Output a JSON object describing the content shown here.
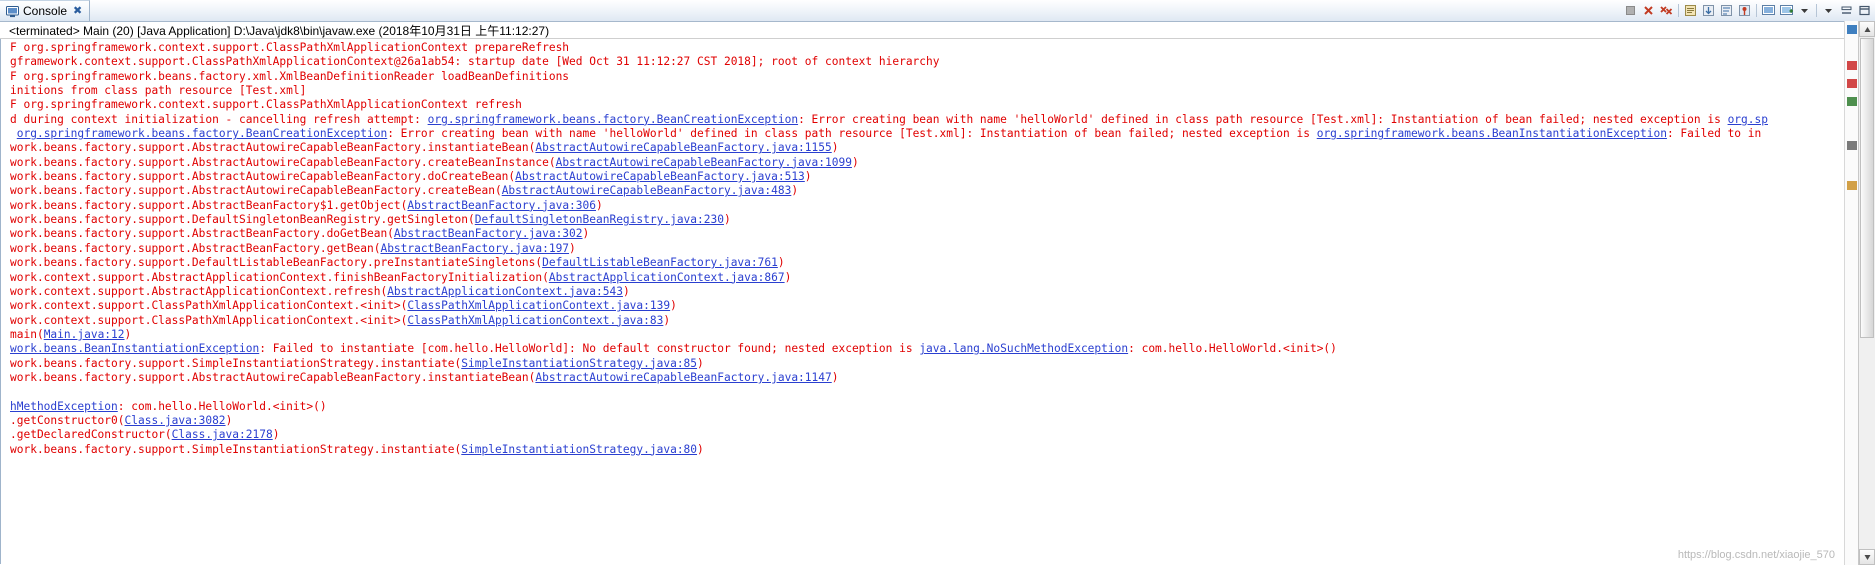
{
  "view": {
    "tab": {
      "label": "Console",
      "icon": "console-icon",
      "close_glyph": "✖"
    },
    "launch_line": "<terminated> Main (20) [Java Application] D:\\Java\\jdk8\\bin\\javaw.exe (2018年10月31日 上午11:12:27)",
    "watermark": "https://blog.csdn.net/xiaojie_570"
  },
  "toolbar": {
    "buttons": [
      {
        "name": "terminate-button",
        "label": "Terminate",
        "glyph": "■"
      },
      {
        "name": "remove-launch-button",
        "label": "Remove Launch",
        "glyph": "✖"
      },
      {
        "name": "remove-all-terminated-button",
        "label": "Remove All Terminated Launches",
        "glyph": "✖✖"
      },
      {
        "name": "clear-console-button",
        "label": "Clear Console",
        "glyph": "⌧"
      },
      {
        "name": "scroll-lock-button",
        "label": "Scroll Lock",
        "glyph": "↧"
      },
      {
        "name": "word-wrap-button",
        "label": "Word Wrap",
        "glyph": "↵"
      },
      {
        "name": "pin-console-button",
        "label": "Pin Console",
        "glyph": "⚓"
      },
      {
        "name": "display-selected-console-button",
        "label": "Display Selected Console",
        "glyph": "▣"
      },
      {
        "name": "open-console-button",
        "label": "Open Console",
        "glyph": "＋"
      },
      {
        "name": "view-menu-button",
        "label": "View Menu",
        "glyph": "▼"
      },
      {
        "name": "minimize-button",
        "label": "Minimize",
        "glyph": "—"
      },
      {
        "name": "maximize-button",
        "label": "Maximize",
        "glyph": "□"
      }
    ]
  },
  "console": {
    "lines": [
      {
        "t": "stack",
        "segments": [
          {
            "text": "F org.springframework.context.support.ClassPathXmlApplicationContext prepareRefresh",
            "link": false
          }
        ]
      },
      {
        "t": "stack",
        "segments": [
          {
            "text": "gframework.context.support.ClassPathXmlApplicationContext@26a1ab54: startup date [Wed Oct 31 11:12:27 CST 2018]; root of context hierarchy",
            "link": false
          }
        ]
      },
      {
        "t": "stack",
        "segments": [
          {
            "text": "F org.springframework.beans.factory.xml.XmlBeanDefinitionReader loadBeanDefinitions",
            "link": false
          }
        ]
      },
      {
        "t": "stack",
        "segments": [
          {
            "text": "initions from class path resource [Test.xml]",
            "link": false
          }
        ]
      },
      {
        "t": "stack",
        "segments": [
          {
            "text": "F org.springframework.context.support.ClassPathXmlApplicationContext refresh",
            "link": false
          }
        ]
      },
      {
        "t": "stack",
        "segments": [
          {
            "text": "d during context initialization - cancelling refresh attempt: ",
            "link": false
          },
          {
            "text": "org.springframework.beans.factory.BeanCreationException",
            "link": true
          },
          {
            "text": ": Error creating bean with name 'helloWorld' defined in class path resource [Test.xml]: Instantiation of bean failed; nested exception is ",
            "link": false
          },
          {
            "text": "org.sp",
            "link": true
          }
        ]
      },
      {
        "t": "stack",
        "segments": [
          {
            "text": " ",
            "link": false
          },
          {
            "text": "org.springframework.beans.factory.BeanCreationException",
            "link": true
          },
          {
            "text": ": Error creating bean with name 'helloWorld' defined in class path resource [Test.xml]: Instantiation of bean failed; nested exception is ",
            "link": false
          },
          {
            "text": "org.springframework.beans.BeanInstantiationException",
            "link": true
          },
          {
            "text": ": Failed to in",
            "link": false
          }
        ]
      },
      {
        "t": "stack",
        "segments": [
          {
            "text": "work.beans.factory.support.AbstractAutowireCapableBeanFactory.instantiateBean(",
            "link": false
          },
          {
            "text": "AbstractAutowireCapableBeanFactory.java:1155",
            "link": true
          },
          {
            "text": ")",
            "link": false
          }
        ]
      },
      {
        "t": "stack",
        "segments": [
          {
            "text": "work.beans.factory.support.AbstractAutowireCapableBeanFactory.createBeanInstance(",
            "link": false
          },
          {
            "text": "AbstractAutowireCapableBeanFactory.java:1099",
            "link": true
          },
          {
            "text": ")",
            "link": false
          }
        ]
      },
      {
        "t": "stack",
        "segments": [
          {
            "text": "work.beans.factory.support.AbstractAutowireCapableBeanFactory.doCreateBean(",
            "link": false
          },
          {
            "text": "AbstractAutowireCapableBeanFactory.java:513",
            "link": true
          },
          {
            "text": ")",
            "link": false
          }
        ]
      },
      {
        "t": "stack",
        "segments": [
          {
            "text": "work.beans.factory.support.AbstractAutowireCapableBeanFactory.createBean(",
            "link": false
          },
          {
            "text": "AbstractAutowireCapableBeanFactory.java:483",
            "link": true
          },
          {
            "text": ")",
            "link": false
          }
        ]
      },
      {
        "t": "stack",
        "segments": [
          {
            "text": "work.beans.factory.support.AbstractBeanFactory$1.getObject(",
            "link": false
          },
          {
            "text": "AbstractBeanFactory.java:306",
            "link": true
          },
          {
            "text": ")",
            "link": false
          }
        ]
      },
      {
        "t": "stack",
        "segments": [
          {
            "text": "work.beans.factory.support.DefaultSingletonBeanRegistry.getSingleton(",
            "link": false
          },
          {
            "text": "DefaultSingletonBeanRegistry.java:230",
            "link": true
          },
          {
            "text": ")",
            "link": false
          }
        ]
      },
      {
        "t": "stack",
        "segments": [
          {
            "text": "work.beans.factory.support.AbstractBeanFactory.doGetBean(",
            "link": false
          },
          {
            "text": "AbstractBeanFactory.java:302",
            "link": true
          },
          {
            "text": ")",
            "link": false
          }
        ]
      },
      {
        "t": "stack",
        "segments": [
          {
            "text": "work.beans.factory.support.AbstractBeanFactory.getBean(",
            "link": false
          },
          {
            "text": "AbstractBeanFactory.java:197",
            "link": true
          },
          {
            "text": ")",
            "link": false
          }
        ]
      },
      {
        "t": "stack",
        "segments": [
          {
            "text": "work.beans.factory.support.DefaultListableBeanFactory.preInstantiateSingletons(",
            "link": false
          },
          {
            "text": "DefaultListableBeanFactory.java:761",
            "link": true
          },
          {
            "text": ")",
            "link": false
          }
        ]
      },
      {
        "t": "stack",
        "segments": [
          {
            "text": "work.context.support.AbstractApplicationContext.finishBeanFactoryInitialization(",
            "link": false
          },
          {
            "text": "AbstractApplicationContext.java:867",
            "link": true
          },
          {
            "text": ")",
            "link": false
          }
        ]
      },
      {
        "t": "stack",
        "segments": [
          {
            "text": "work.context.support.AbstractApplicationContext.refresh(",
            "link": false
          },
          {
            "text": "AbstractApplicationContext.java:543",
            "link": true
          },
          {
            "text": ")",
            "link": false
          }
        ]
      },
      {
        "t": "stack",
        "segments": [
          {
            "text": "work.context.support.ClassPathXmlApplicationContext.<init>(",
            "link": false
          },
          {
            "text": "ClassPathXmlApplicationContext.java:139",
            "link": true
          },
          {
            "text": ")",
            "link": false
          }
        ]
      },
      {
        "t": "stack",
        "segments": [
          {
            "text": "work.context.support.ClassPathXmlApplicationContext.<init>(",
            "link": false
          },
          {
            "text": "ClassPathXmlApplicationContext.java:83",
            "link": true
          },
          {
            "text": ")",
            "link": false
          }
        ]
      },
      {
        "t": "stack",
        "segments": [
          {
            "text": "main(",
            "link": false
          },
          {
            "text": "Main.java:12",
            "link": true
          },
          {
            "text": ")",
            "link": false
          }
        ]
      },
      {
        "t": "stack",
        "segments": [
          {
            "text": "work.beans.BeanInstantiationException",
            "link": true
          },
          {
            "text": ": Failed to instantiate [com.hello.HelloWorld]: No default constructor found; nested exception is ",
            "link": false
          },
          {
            "text": "java.lang.NoSuchMethodException",
            "link": true
          },
          {
            "text": ": com.hello.HelloWorld.<init>()",
            "link": false
          }
        ]
      },
      {
        "t": "stack",
        "segments": [
          {
            "text": "work.beans.factory.support.SimpleInstantiationStrategy.instantiate(",
            "link": false
          },
          {
            "text": "SimpleInstantiationStrategy.java:85",
            "link": true
          },
          {
            "text": ")",
            "link": false
          }
        ]
      },
      {
        "t": "stack",
        "segments": [
          {
            "text": "work.beans.factory.support.AbstractAutowireCapableBeanFactory.instantiateBean(",
            "link": false
          },
          {
            "text": "AbstractAutowireCapableBeanFactory.java:1147",
            "link": true
          },
          {
            "text": ")",
            "link": false
          }
        ]
      },
      {
        "t": "blank",
        "segments": []
      },
      {
        "t": "stack",
        "segments": [
          {
            "text": "hMethodException",
            "link": true
          },
          {
            "text": ": com.hello.HelloWorld.<init>()",
            "link": false
          }
        ]
      },
      {
        "t": "stack",
        "segments": [
          {
            "text": ".getConstructor0(",
            "link": false
          },
          {
            "text": "Class.java:3082",
            "link": true
          },
          {
            "text": ")",
            "link": false
          }
        ]
      },
      {
        "t": "stack",
        "segments": [
          {
            "text": ".getDeclaredConstructor(",
            "link": false
          },
          {
            "text": "Class.java:2178",
            "link": true
          },
          {
            "text": ")",
            "link": false
          }
        ]
      },
      {
        "t": "stack",
        "segments": [
          {
            "text": "work.beans.factory.support.SimpleInstantiationStrategy.instantiate(",
            "link": false
          },
          {
            "text": "SimpleInstantiationStrategy.java:80",
            "link": true
          },
          {
            "text": ")",
            "link": false
          }
        ]
      }
    ]
  },
  "colors": {
    "error_text": "#e00000",
    "link_text": "#2a3fd0",
    "tab_background": "#dbe6f2",
    "page_background": "#ffffff"
  }
}
